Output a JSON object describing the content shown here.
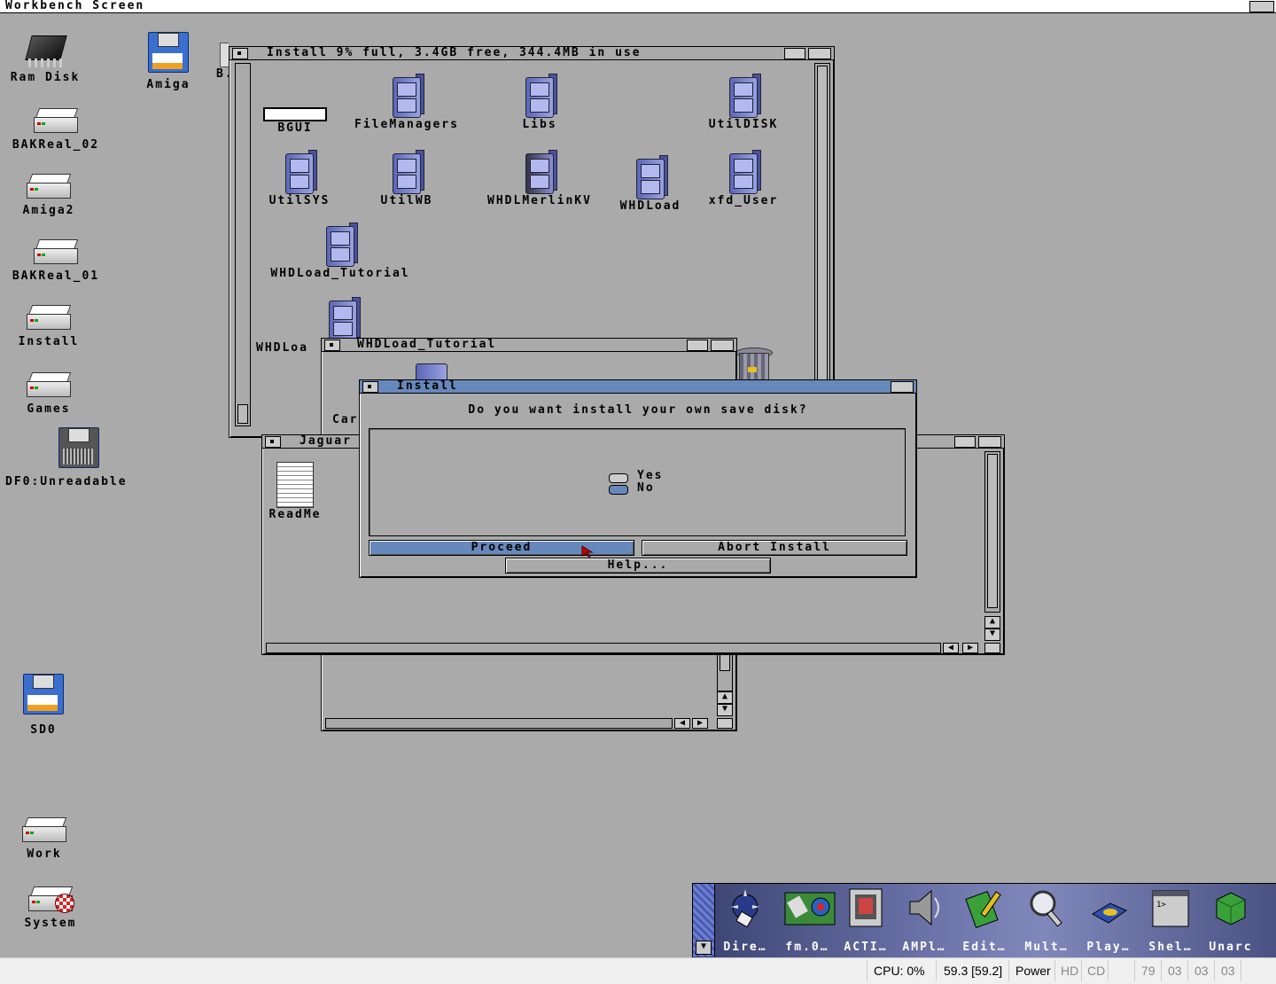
{
  "screen": {
    "title": "Workbench Screen"
  },
  "desktop_icons": {
    "ram_disk": "Ram Disk",
    "amiga": "Amiga",
    "partial_b": "B.",
    "bakreal_02": "BAKReal_02",
    "amiga2": "Amiga2",
    "bakreal_01": "BAKReal_01",
    "install": "Install",
    "games": "Games",
    "df0": "DF0:Unreadable",
    "sd0": "SD0",
    "work": "Work",
    "system": "System"
  },
  "install_window": {
    "title": "Install   9% full, 3.4GB free, 344.4MB  in  use",
    "icons": [
      "BGUI",
      "FileManagers",
      "Libs",
      "UtilDISK",
      "UtilSYS",
      "UtilWB",
      "WHDLMerlinKV",
      "WHDLoad",
      "xfd_User",
      "WHDLoad_Tutorial",
      "WHDLoa"
    ]
  },
  "tutorial_window": {
    "title": "WHDLoad_Tutorial",
    "partial_label": "Car"
  },
  "jaguar_window": {
    "title": "Jaguar",
    "icon_label": "ReadMe"
  },
  "dialog": {
    "title": "Install",
    "question": "Do you want install your own save disk?",
    "options": [
      "Yes",
      "No"
    ],
    "selected": "No",
    "proceed": "Proceed",
    "abort": "Abort Install",
    "help": "Help..."
  },
  "dock": {
    "items": [
      "Dire…",
      "fm.0…",
      "ACTI…",
      "AMPl…",
      "Edit…",
      "Mult…",
      "Play…",
      "Shel…",
      "Unarc"
    ]
  },
  "status_bar": {
    "cpu": "CPU: 0%",
    "fps": "59.3 [59.2]",
    "power": "Power",
    "hd": "HD",
    "cd": "CD",
    "counters": [
      "79",
      "03",
      "03",
      "03"
    ]
  }
}
